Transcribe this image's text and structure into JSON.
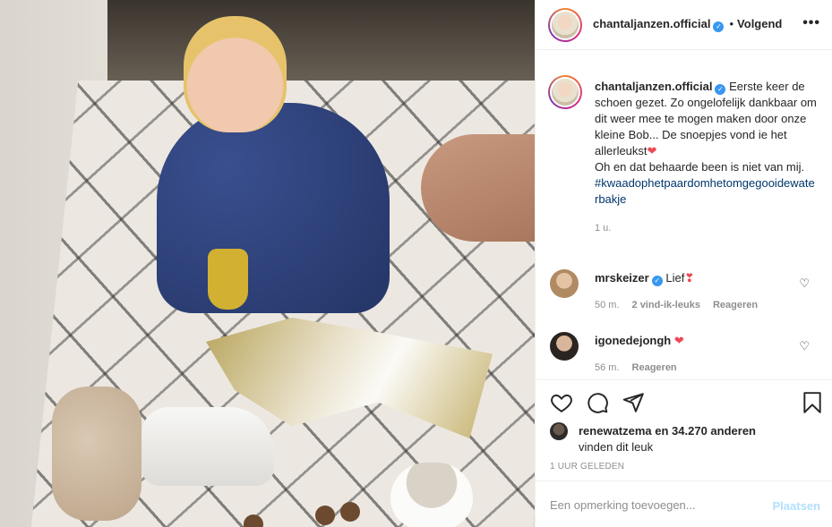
{
  "photo": {
    "alt": ""
  },
  "header": {
    "username": "chantaljanzen.official",
    "dot": "•",
    "follow_label": "Volgend",
    "more_icon": "more-horizontal-icon",
    "more_glyph": "•••"
  },
  "caption": {
    "username": "chantaljanzen.official",
    "text": "Eerste keer de schoen gezet. Zo ongelofelijk dankbaar om dit weer mee te mogen maken door onze kleine Bob... De snoepjes vond ie het allerleukst",
    "text2": "Oh en dat behaarde been is niet van mij.",
    "hashtag": "#kwaadophetpaardomhetomgegooidewaterbakje",
    "time": "1 u."
  },
  "comments": [
    {
      "username": "mrskeizer",
      "text": "Lief",
      "time": "50 m.",
      "likes": "2 vind-ik-leuks",
      "reply": "Reageren",
      "heart_emoji": "❣"
    },
    {
      "username": "igonedejongh",
      "text": "",
      "time": "56 m.",
      "reply": "Reageren",
      "heart_emoji": "❤"
    }
  ],
  "actions": {
    "icons": [
      "heart-icon",
      "comment-icon",
      "share-icon",
      "bookmark-icon"
    ],
    "liked_by_user": "renewatzema",
    "liked_by_rest": " en 34.270 anderen",
    "liked_by_suffix": "vinden dit leuk",
    "time_ago": "1 UUR GELEDEN"
  },
  "add_comment": {
    "placeholder": "Een opmerking toevoegen...",
    "post_label": "Plaatsen"
  },
  "colors": {
    "verified": "#3897f0",
    "link": "#00376b",
    "heart": "#ed4956",
    "post_disabled": "#b2dffc",
    "muted": "#8e8e8e"
  }
}
